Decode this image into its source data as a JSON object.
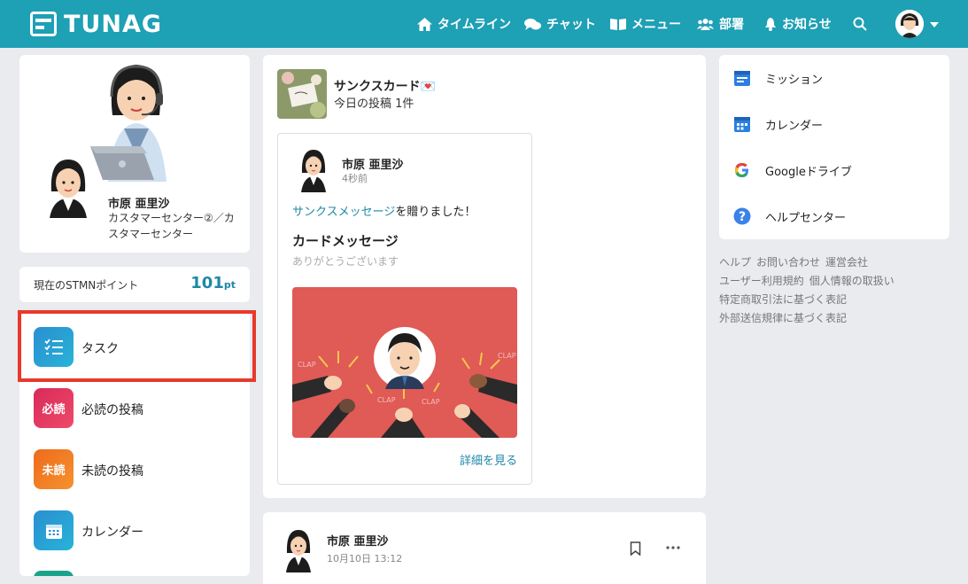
{
  "header": {
    "brand": "TUNAG",
    "nav": [
      {
        "label": "タイムライン",
        "icon": "home-icon"
      },
      {
        "label": "チャット",
        "icon": "chat-icon"
      },
      {
        "label": "メニュー",
        "icon": "book-icon"
      },
      {
        "label": "部署",
        "icon": "people-icon"
      },
      {
        "label": "お知らせ",
        "icon": "bell-icon"
      }
    ],
    "search_icon": "search-icon",
    "accent": "#1ea0b5"
  },
  "profile": {
    "name": "市原 亜里沙",
    "department": "カスタマーセンター②／カスタマーセンター"
  },
  "points": {
    "label": "現在のSTMNポイント",
    "value": "101",
    "unit": "pt"
  },
  "left_menu": [
    {
      "label": "タスク",
      "icon": "task-list-icon",
      "icon_text": "",
      "color": "#2a8fd0"
    },
    {
      "label": "必読の投稿",
      "icon": "must-read-icon",
      "icon_text": "必読",
      "color": "#e0345d"
    },
    {
      "label": "未読の投稿",
      "icon": "unread-icon",
      "icon_text": "未読",
      "color": "#f07a22"
    },
    {
      "label": "カレンダー",
      "icon": "calendar-icon",
      "icon_text": "",
      "color": "#2a8fd0"
    }
  ],
  "thanks_card": {
    "title": "サンクスカード💌",
    "subtitle": "今日の投稿 1件",
    "post": {
      "author": "市原 亜里沙",
      "time": "4秒前",
      "sent_link": "サンクスメッセージ",
      "sent_rest": "を贈りました！",
      "message_title": "カードメッセージ",
      "message_body": "ありがとうございます",
      "detail_link": "詳細を見る",
      "image_color": "#e05a56"
    }
  },
  "second_post": {
    "author": "市原 亜里沙",
    "time": "10月10日 13:12"
  },
  "right_links": [
    {
      "label": "ミッション",
      "icon": "mission-icon"
    },
    {
      "label": "カレンダー",
      "icon": "calendar-icon"
    },
    {
      "label": "Googleドライブ",
      "icon": "google-icon"
    },
    {
      "label": "ヘルプセンター",
      "icon": "help-icon"
    }
  ],
  "footer": {
    "links": [
      "ヘルプ",
      "お問い合わせ",
      "運営会社",
      "ユーザー利用規約",
      "個人情報の取扱い",
      "特定商取引法に基づく表記",
      "外部送信規律に基づく表記"
    ]
  }
}
